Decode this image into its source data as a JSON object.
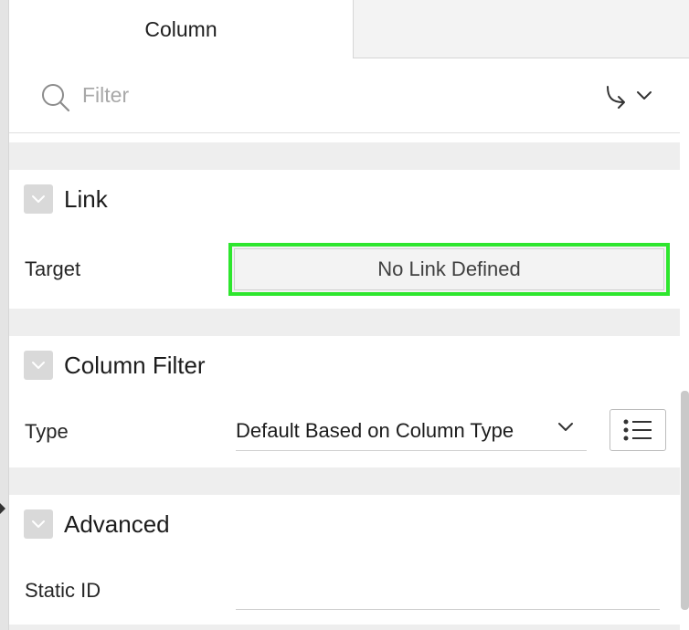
{
  "tabs": [
    {
      "label": "Column",
      "active": true
    }
  ],
  "filter": {
    "placeholder": "Filter",
    "value": ""
  },
  "sections": {
    "link": {
      "title": "Link",
      "target_label": "Target",
      "target_value": "No Link Defined"
    },
    "column_filter": {
      "title": "Column Filter",
      "type_label": "Type",
      "type_value": "Default Based on Column Type"
    },
    "advanced": {
      "title": "Advanced",
      "static_id_label": "Static ID",
      "static_id_value": ""
    }
  },
  "icons": {
    "search": "search-icon",
    "goto": "goto-group-icon",
    "collapse": "chevron-down-icon",
    "list": "list-icon"
  },
  "colors": {
    "highlight": "#2ee62e",
    "band": "#eeeeee",
    "collapse_box": "#d9d9d9"
  }
}
